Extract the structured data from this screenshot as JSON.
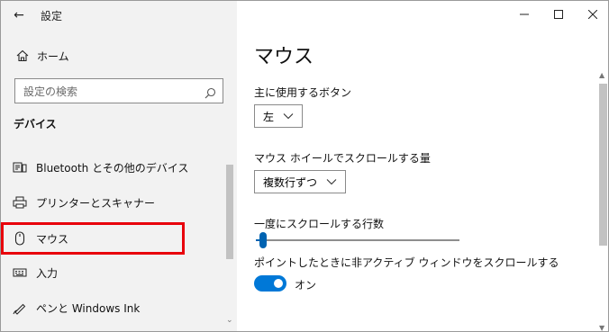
{
  "app": {
    "title": "設定"
  },
  "window_controls": {
    "minimize": "—",
    "maximize": "☐",
    "close": "✕"
  },
  "sidebar": {
    "home_label": "ホーム",
    "search_placeholder": "設定の検索",
    "section_title": "デバイス",
    "items": [
      {
        "label": "Bluetooth とその他のデバイス",
        "icon": "bluetooth-devices-icon"
      },
      {
        "label": "プリンターとスキャナー",
        "icon": "printer-icon"
      },
      {
        "label": "マウス",
        "icon": "mouse-icon",
        "selected": true
      },
      {
        "label": "入力",
        "icon": "keyboard-icon"
      },
      {
        "label": "ペンと Windows Ink",
        "icon": "pen-icon"
      }
    ]
  },
  "main": {
    "title": "マウス",
    "primary_button": {
      "label": "主に使用するボタン",
      "value": "左"
    },
    "wheel_scroll": {
      "label": "マウス ホイールでスクロールする量",
      "value": "複数行ずつ"
    },
    "lines_to_scroll": {
      "label": "一度にスクロールする行数",
      "value_fraction": 0.02
    },
    "inactive_scroll": {
      "label": "ポイントしたときに非アクティブ ウィンドウをスクロールする",
      "state": "オン",
      "on": true
    }
  },
  "colors": {
    "accent": "#0078d7",
    "highlight_box": "#e8000b",
    "sidebar_bg": "#f2f2f2"
  }
}
